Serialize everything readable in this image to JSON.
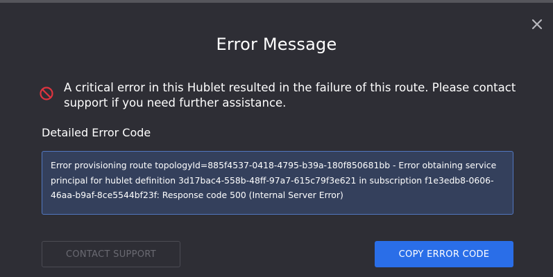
{
  "modal": {
    "title": "Error Message",
    "close_icon": "close-icon",
    "alert": {
      "icon": "no-entry-icon",
      "icon_color": "#e0343f",
      "message": "A critical error in this Hublet resulted in the failure of this route. Please contact support if you need further assistance."
    },
    "detail_label": "Detailed Error Code",
    "error_code": "Error provisioning route topologyId=885f4537-0418-4795-b39a-180f850681bb - Error obtaining service principal for hublet definition 3d17bac4-558b-48ff-97a7-615c79f3e621 in subscription f1e3edb8-0606-46aa-b9af-8ce5544bf23f: Response code 500 (Internal Server Error)",
    "buttons": {
      "contact_support": "CONTACT SUPPORT",
      "copy_error_code": "COPY ERROR CODE"
    }
  },
  "colors": {
    "background": "#2e2e35",
    "accent": "#2a6ee8",
    "error_box_bg": "#34405c",
    "error_box_border": "#5278c2",
    "error_icon": "#e0343f"
  }
}
